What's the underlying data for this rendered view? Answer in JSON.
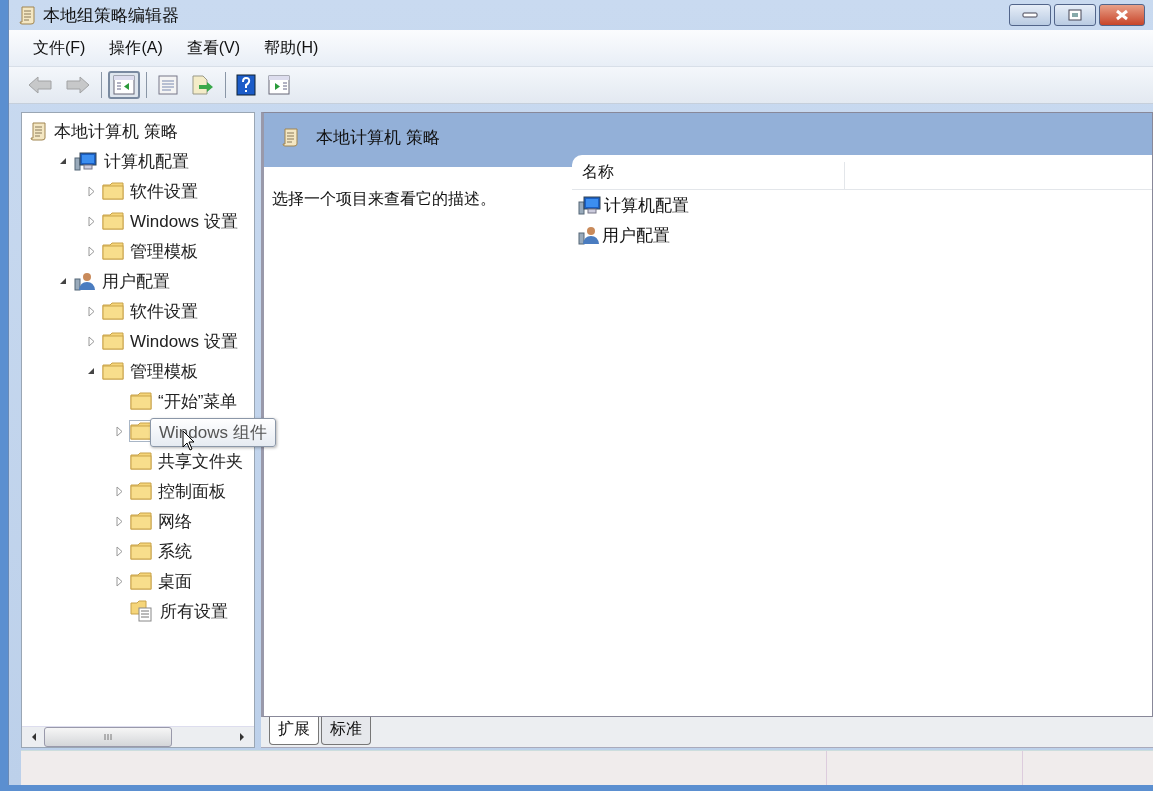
{
  "window": {
    "title": "本地组策略编辑器"
  },
  "menu": [
    "文件(F)",
    "操作(A)",
    "查看(V)",
    "帮助(H)"
  ],
  "toolbar": [
    {
      "kind": "back",
      "disabled": true,
      "pressed": false
    },
    {
      "kind": "forward",
      "disabled": true,
      "pressed": false
    },
    {
      "kind": "sep"
    },
    {
      "kind": "tree-toggle",
      "disabled": false,
      "pressed": true
    },
    {
      "kind": "sep"
    },
    {
      "kind": "properties",
      "disabled": false,
      "pressed": false
    },
    {
      "kind": "export",
      "disabled": false,
      "pressed": false
    },
    {
      "kind": "sep"
    },
    {
      "kind": "help",
      "disabled": false,
      "pressed": false
    },
    {
      "kind": "action-toggle",
      "disabled": false,
      "pressed": false
    }
  ],
  "tree": [
    {
      "label": "本地计算机 策略",
      "kind": "policy",
      "children": [
        {
          "label": "计算机配置",
          "kind": "computer",
          "expanded": true,
          "children": [
            {
              "label": "软件设置",
              "kind": "folder",
              "expanded": false
            },
            {
              "label": "Windows 设置",
              "kind": "folder",
              "expanded": false
            },
            {
              "label": "管理模板",
              "kind": "folder",
              "expanded": false
            }
          ]
        },
        {
          "label": "用户配置",
          "kind": "user",
          "expanded": true,
          "children": [
            {
              "label": "软件设置",
              "kind": "folder",
              "expanded": false
            },
            {
              "label": "Windows 设置",
              "kind": "folder",
              "expanded": false
            },
            {
              "label": "管理模板",
              "kind": "folder",
              "expanded": true,
              "children": [
                {
                  "label": "“开始”菜单",
                  "kind": "folder"
                },
                {
                  "tooltip": "Windows 组件",
                  "kind": "folder",
                  "expanded": false,
                  "hovered": true
                },
                {
                  "label": "共享文件夹",
                  "kind": "folder"
                },
                {
                  "label": "控制面板",
                  "kind": "folder",
                  "expanded": false
                },
                {
                  "label": "网络",
                  "kind": "folder",
                  "expanded": false
                },
                {
                  "label": "系统",
                  "kind": "folder",
                  "expanded": false
                },
                {
                  "label": "桌面",
                  "kind": "folder",
                  "expanded": false
                },
                {
                  "label": "所有设置",
                  "kind": "settings"
                }
              ]
            }
          ]
        }
      ]
    }
  ],
  "details": {
    "heading": "本地计算机 策略",
    "description": "选择一个项目来查看它的描述。",
    "columns": [
      "名称"
    ],
    "items": [
      {
        "label": "计算机配置",
        "kind": "computer"
      },
      {
        "label": "用户配置",
        "kind": "user"
      }
    ]
  },
  "view_tabs": [
    {
      "label": "扩展",
      "selected": true
    },
    {
      "label": "标准",
      "selected": false
    }
  ]
}
